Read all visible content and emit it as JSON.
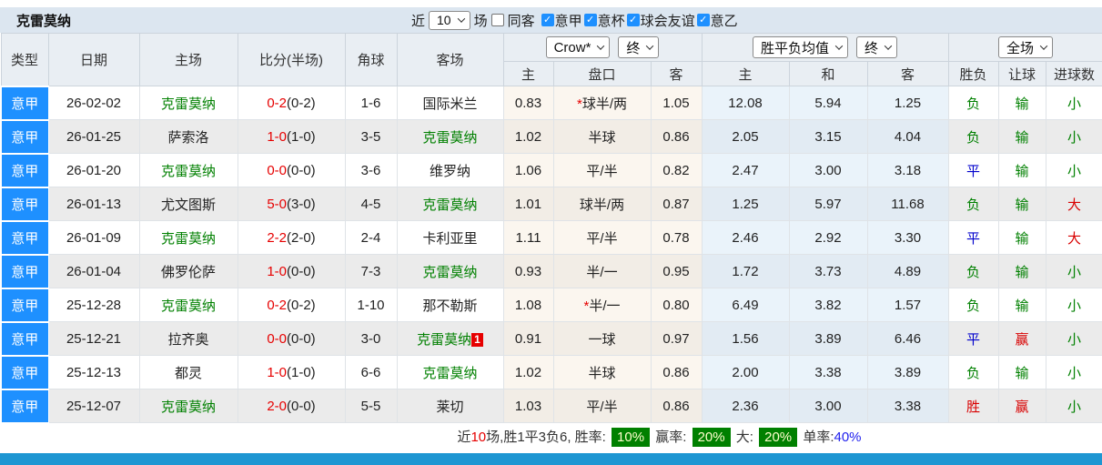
{
  "title": "克雷莫纳",
  "colors": {
    "accent_blue": "#1e90ff",
    "bottom_bar_blue": "#1e96d2",
    "win_green": "#008000",
    "loss_red": "#d80000",
    "draw_blue": "#0000cc",
    "badge_green_bg": "#008000"
  },
  "icons": {
    "check": "✓",
    "asterisk": "*"
  },
  "topbar": {
    "near_label": "近",
    "count_value": "10",
    "games_label": "场",
    "same_away_label": "同客",
    "same_away_checked": false,
    "filters": [
      {
        "label": "意甲",
        "checked": true
      },
      {
        "label": "意杯",
        "checked": true
      },
      {
        "label": "球会友谊",
        "checked": true
      },
      {
        "label": "意乙",
        "checked": true
      }
    ]
  },
  "header": {
    "col_type": "类型",
    "col_date": "日期",
    "col_home": "主场",
    "col_score": "比分(半场)",
    "col_corner": "角球",
    "col_away": "客场",
    "asia_select": "Crow*",
    "asia_time_select": "终",
    "europe_select": "胜平负均值",
    "europe_time_select": "终",
    "result_select": "全场",
    "sub_asia_home": "主",
    "sub_handicap": "盘口",
    "sub_asia_away": "客",
    "sub_euro_home": "主",
    "sub_euro_draw": "和",
    "sub_euro_away": "客",
    "sub_result": "胜负",
    "sub_handicap_result": "让球",
    "sub_goals": "进球数"
  },
  "rows": [
    {
      "league": "意甲",
      "date": "26-02-02",
      "home": "克雷莫纳",
      "home_green": true,
      "score": "0-2",
      "half": "(0-2)",
      "corners": "1-6",
      "away": "国际米兰",
      "away_green": false,
      "away_badge": "",
      "ah_home": "0.83",
      "handicap_mark": "*",
      "handicap": "球半/两",
      "ah_away": "1.05",
      "odds_home": "12.08",
      "odds_draw": "5.94",
      "odds_away": "1.25",
      "result": "负",
      "result_color": "green",
      "handicap_result": "输",
      "handicap_result_color": "green",
      "goals_result": "小",
      "goals_result_color": "green"
    },
    {
      "league": "意甲",
      "date": "26-01-25",
      "home": "萨索洛",
      "home_green": false,
      "score": "1-0",
      "half": "(1-0)",
      "corners": "3-5",
      "away": "克雷莫纳",
      "away_green": true,
      "away_badge": "",
      "ah_home": "1.02",
      "handicap_mark": "",
      "handicap": "半球",
      "ah_away": "0.86",
      "odds_home": "2.05",
      "odds_draw": "3.15",
      "odds_away": "4.04",
      "result": "负",
      "result_color": "green",
      "handicap_result": "输",
      "handicap_result_color": "green",
      "goals_result": "小",
      "goals_result_color": "green"
    },
    {
      "league": "意甲",
      "date": "26-01-20",
      "home": "克雷莫纳",
      "home_green": true,
      "score": "0-0",
      "half": "(0-0)",
      "corners": "3-6",
      "away": "维罗纳",
      "away_green": false,
      "away_badge": "",
      "ah_home": "1.06",
      "handicap_mark": "",
      "handicap": "平/半",
      "ah_away": "0.82",
      "odds_home": "2.47",
      "odds_draw": "3.00",
      "odds_away": "3.18",
      "result": "平",
      "result_color": "blue",
      "handicap_result": "输",
      "handicap_result_color": "green",
      "goals_result": "小",
      "goals_result_color": "green"
    },
    {
      "league": "意甲",
      "date": "26-01-13",
      "home": "尤文图斯",
      "home_green": false,
      "score": "5-0",
      "half": "(3-0)",
      "corners": "4-5",
      "away": "克雷莫纳",
      "away_green": true,
      "away_badge": "",
      "ah_home": "1.01",
      "handicap_mark": "",
      "handicap": "球半/两",
      "ah_away": "0.87",
      "odds_home": "1.25",
      "odds_draw": "5.97",
      "odds_away": "11.68",
      "result": "负",
      "result_color": "green",
      "handicap_result": "输",
      "handicap_result_color": "green",
      "goals_result": "大",
      "goals_result_color": "red"
    },
    {
      "league": "意甲",
      "date": "26-01-09",
      "home": "克雷莫纳",
      "home_green": true,
      "score": "2-2",
      "half": "(2-0)",
      "corners": "2-4",
      "away": "卡利亚里",
      "away_green": false,
      "away_badge": "",
      "ah_home": "1.11",
      "handicap_mark": "",
      "handicap": "平/半",
      "ah_away": "0.78",
      "odds_home": "2.46",
      "odds_draw": "2.92",
      "odds_away": "3.30",
      "result": "平",
      "result_color": "blue",
      "handicap_result": "输",
      "handicap_result_color": "green",
      "goals_result": "大",
      "goals_result_color": "red"
    },
    {
      "league": "意甲",
      "date": "26-01-04",
      "home": "佛罗伦萨",
      "home_green": false,
      "score": "1-0",
      "half": "(0-0)",
      "corners": "7-3",
      "away": "克雷莫纳",
      "away_green": true,
      "away_badge": "",
      "ah_home": "0.93",
      "handicap_mark": "",
      "handicap": "半/一",
      "ah_away": "0.95",
      "odds_home": "1.72",
      "odds_draw": "3.73",
      "odds_away": "4.89",
      "result": "负",
      "result_color": "green",
      "handicap_result": "输",
      "handicap_result_color": "green",
      "goals_result": "小",
      "goals_result_color": "green"
    },
    {
      "league": "意甲",
      "date": "25-12-28",
      "home": "克雷莫纳",
      "home_green": true,
      "score": "0-2",
      "half": "(0-2)",
      "corners": "1-10",
      "away": "那不勒斯",
      "away_green": false,
      "away_badge": "",
      "ah_home": "1.08",
      "handicap_mark": "*",
      "handicap": "半/一",
      "ah_away": "0.80",
      "odds_home": "6.49",
      "odds_draw": "3.82",
      "odds_away": "1.57",
      "result": "负",
      "result_color": "green",
      "handicap_result": "输",
      "handicap_result_color": "green",
      "goals_result": "小",
      "goals_result_color": "green"
    },
    {
      "league": "意甲",
      "date": "25-12-21",
      "home": "拉齐奥",
      "home_green": false,
      "score": "0-0",
      "half": "(0-0)",
      "corners": "3-0",
      "away": "克雷莫纳",
      "away_green": true,
      "away_badge": "1",
      "ah_home": "0.91",
      "handicap_mark": "",
      "handicap": "一球",
      "ah_away": "0.97",
      "odds_home": "1.56",
      "odds_draw": "3.89",
      "odds_away": "6.46",
      "result": "平",
      "result_color": "blue",
      "handicap_result": "赢",
      "handicap_result_color": "red",
      "goals_result": "小",
      "goals_result_color": "green"
    },
    {
      "league": "意甲",
      "date": "25-12-13",
      "home": "都灵",
      "home_green": false,
      "score": "1-0",
      "half": "(1-0)",
      "corners": "6-6",
      "away": "克雷莫纳",
      "away_green": true,
      "away_badge": "",
      "ah_home": "1.02",
      "handicap_mark": "",
      "handicap": "半球",
      "ah_away": "0.86",
      "odds_home": "2.00",
      "odds_draw": "3.38",
      "odds_away": "3.89",
      "result": "负",
      "result_color": "green",
      "handicap_result": "输",
      "handicap_result_color": "green",
      "goals_result": "小",
      "goals_result_color": "green"
    },
    {
      "league": "意甲",
      "date": "25-12-07",
      "home": "克雷莫纳",
      "home_green": true,
      "score": "2-0",
      "half": "(0-0)",
      "corners": "5-5",
      "away": "莱切",
      "away_green": false,
      "away_badge": "",
      "ah_home": "1.03",
      "handicap_mark": "",
      "handicap": "平/半",
      "ah_away": "0.86",
      "odds_home": "2.36",
      "odds_draw": "3.00",
      "odds_away": "3.38",
      "result": "胜",
      "result_color": "red",
      "handicap_result": "赢",
      "handicap_result_color": "red",
      "goals_result": "小",
      "goals_result_color": "green"
    }
  ],
  "footer": {
    "near_label": "近",
    "count": "10",
    "summary": "场,胜1平3负6, 胜率:",
    "win_rate": "10%",
    "win_odds_label": "赢率:",
    "win_odds_rate": "20%",
    "big_label": "大:",
    "big_rate": "20%",
    "single_label": "单率:",
    "single_rate": "40%"
  }
}
